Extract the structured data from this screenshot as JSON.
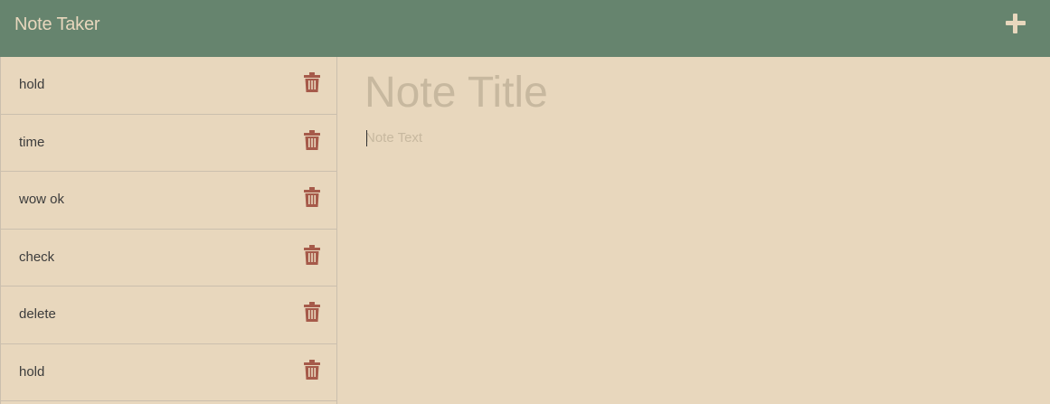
{
  "navbar": {
    "brand": "Note Taker",
    "new_note_icon": "plus-icon"
  },
  "notes": [
    {
      "title": "hold"
    },
    {
      "title": "time"
    },
    {
      "title": "wow ok"
    },
    {
      "title": "check"
    },
    {
      "title": "delete"
    },
    {
      "title": "hold"
    }
  ],
  "editor": {
    "title_placeholder": "Note Title",
    "text_placeholder": "Note Text"
  },
  "colors": {
    "navbar_bg": "#66846e",
    "page_bg": "#e8d7bd",
    "delete_icon": "#a65a4a",
    "placeholder": "#c7b89f"
  }
}
